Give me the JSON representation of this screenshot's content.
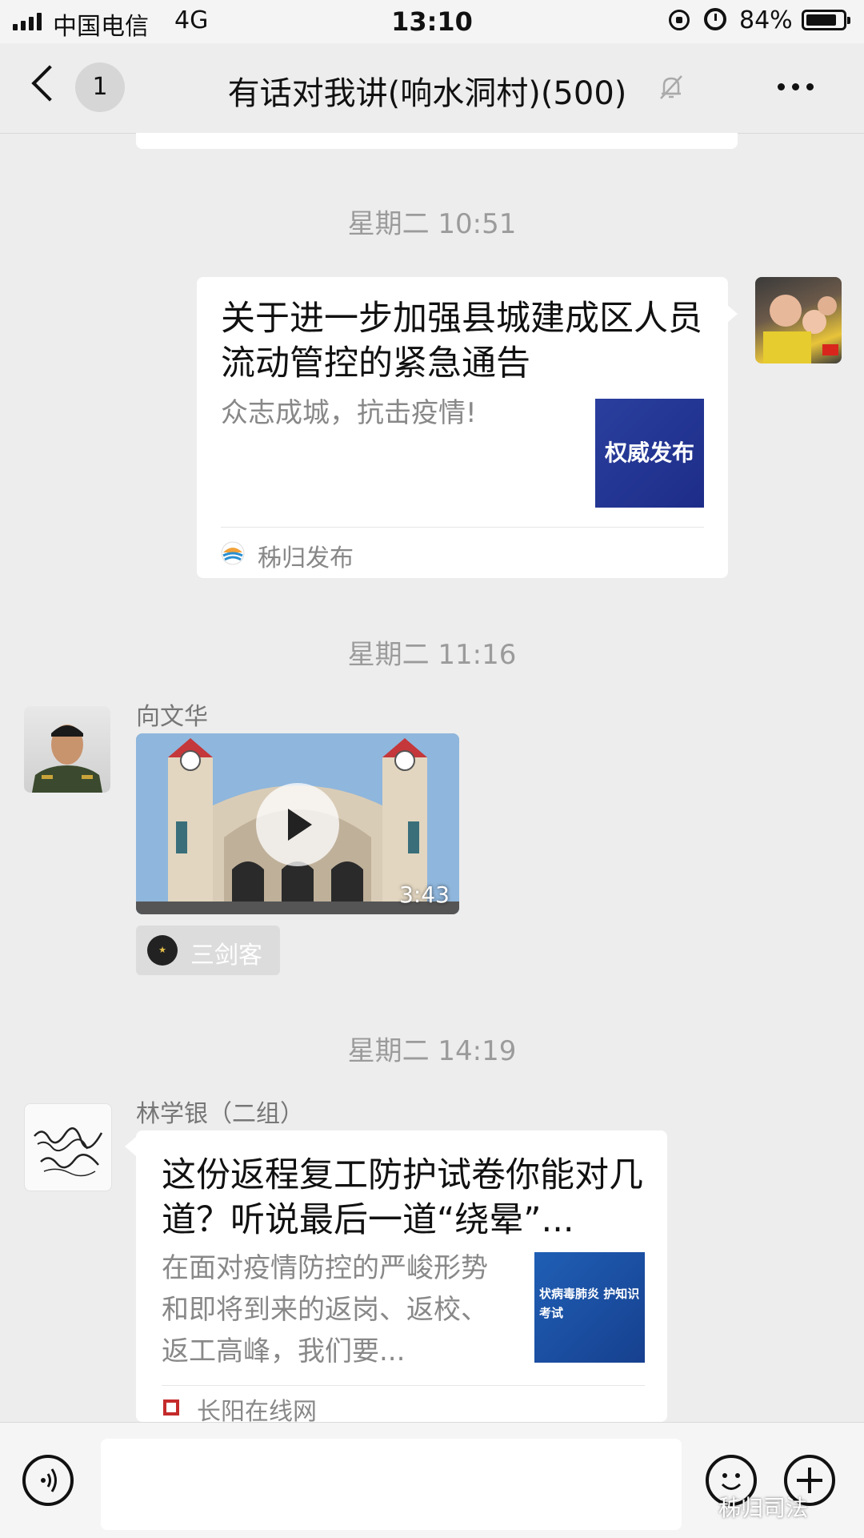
{
  "status_bar": {
    "carrier": "中国电信",
    "network": "4G",
    "time": "13:10",
    "battery": "84%",
    "battery_level": 0.84
  },
  "nav": {
    "unread_count": "1",
    "title": "有话对我讲(响水洞村)(500)"
  },
  "messages": [
    {
      "time": "星期二 10:51",
      "card_title": "关于进一步加强县城建成区人员流动管控的紧急通告",
      "card_desc": "众志成城，抗击疫情!",
      "thumb_text": "权威发布",
      "source": "秭归发布"
    },
    {
      "time": "星期二 11:16",
      "sender": "向文华",
      "video_duration": "3:43",
      "channel_tag": "三剑客"
    },
    {
      "time": "星期二 14:19",
      "sender": "林学银（二组）",
      "card_title": "这份返程复工防护试卷你能对几道？听说最后一道“绕晕”...",
      "card_desc": "在面对疫情防控的严峻形势和即将到来的返岗、返校、返工高峰，我们要...",
      "thumb_text": "状病毒肺炎 护知识考试",
      "source": "长阳在线网"
    }
  ],
  "watermark": "秭归司法"
}
